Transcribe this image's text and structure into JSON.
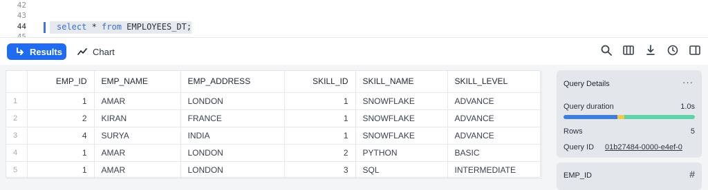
{
  "editor": {
    "line_numbers": [
      "42",
      "43",
      "44",
      "45"
    ],
    "code": {
      "kw1": "select",
      "star": " * ",
      "kw2": "from",
      "table": " EMPLOYEES_DT;"
    }
  },
  "toolbar": {
    "results_label": "Results",
    "chart_label": "Chart",
    "accent": "#1f6cf0"
  },
  "grid": {
    "columns": [
      "EMP_ID",
      "EMP_NAME",
      "EMP_ADDRESS",
      "SKILL_ID",
      "SKILL_NAME",
      "SKILL_LEVEL"
    ],
    "rows": [
      {
        "n": "1",
        "emp_id": "1",
        "emp_name": "AMAR",
        "emp_address": "LONDON",
        "skill_id": "1",
        "skill_name": "SNOWFLAKE",
        "skill_level": "ADVANCE"
      },
      {
        "n": "2",
        "emp_id": "2",
        "emp_name": "KIRAN",
        "emp_address": "FRANCE",
        "skill_id": "1",
        "skill_name": "SNOWFLAKE",
        "skill_level": "ADVANCE"
      },
      {
        "n": "3",
        "emp_id": "4",
        "emp_name": "SURYA",
        "emp_address": "INDIA",
        "skill_id": "1",
        "skill_name": "SNOWFLAKE",
        "skill_level": "ADVANCE"
      },
      {
        "n": "4",
        "emp_id": "1",
        "emp_name": "AMAR",
        "emp_address": "LONDON",
        "skill_id": "2",
        "skill_name": "PYTHON",
        "skill_level": "BASIC"
      },
      {
        "n": "5",
        "emp_id": "1",
        "emp_name": "AMAR",
        "emp_address": "LONDON",
        "skill_id": "3",
        "skill_name": "SQL",
        "skill_level": "INTERMEDIATE"
      }
    ]
  },
  "query_details": {
    "title": "Query Details",
    "more": "···",
    "duration_label": "Query duration",
    "duration_value": "1.0s",
    "duration_colors": [
      "#3d7fe0",
      "#f2c94c",
      "#5fd3a8"
    ],
    "rows_label": "Rows",
    "rows_value": "5",
    "query_id_label": "Query ID",
    "query_id_value": "01b27484-0000-e4ef-0"
  },
  "column_panel": {
    "title": "EMP_ID",
    "type_icon": "#"
  }
}
